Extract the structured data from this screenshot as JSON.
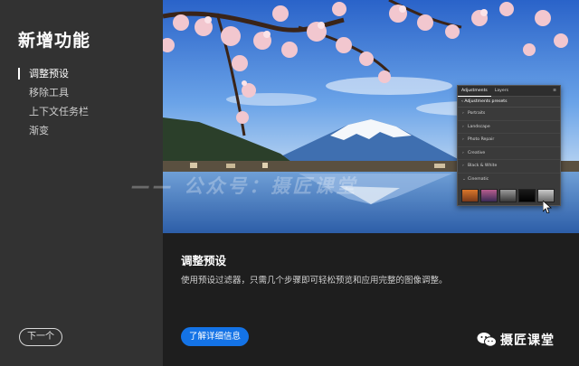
{
  "sidebar": {
    "title": "新增功能",
    "items": [
      {
        "label": "调整预设",
        "active": true
      },
      {
        "label": "移除工具",
        "active": false
      },
      {
        "label": "上下文任务栏",
        "active": false
      },
      {
        "label": "渐变",
        "active": false
      }
    ],
    "next_label": "下一个"
  },
  "adjustments_panel": {
    "tabs": [
      "Adjustments",
      "Layers"
    ],
    "header": "Adjustments presets",
    "rows": [
      "Portraits",
      "Landscape",
      "Photo Repair",
      "Creative",
      "Black & White",
      "Cinematic"
    ]
  },
  "watermark": "—— 公众号：摄匠课堂",
  "content": {
    "title": "调整预设",
    "description": "使用预设过滤器，只需几个步骤即可轻松预览和应用完整的图像调整。",
    "more_label": "了解详细信息"
  },
  "brand": {
    "text": "摄匠课堂",
    "icon": "wechat-icon"
  },
  "colors": {
    "sidebar_bg": "#323232",
    "content_bg": "#1e1e1e",
    "accent": "#1473e6"
  }
}
